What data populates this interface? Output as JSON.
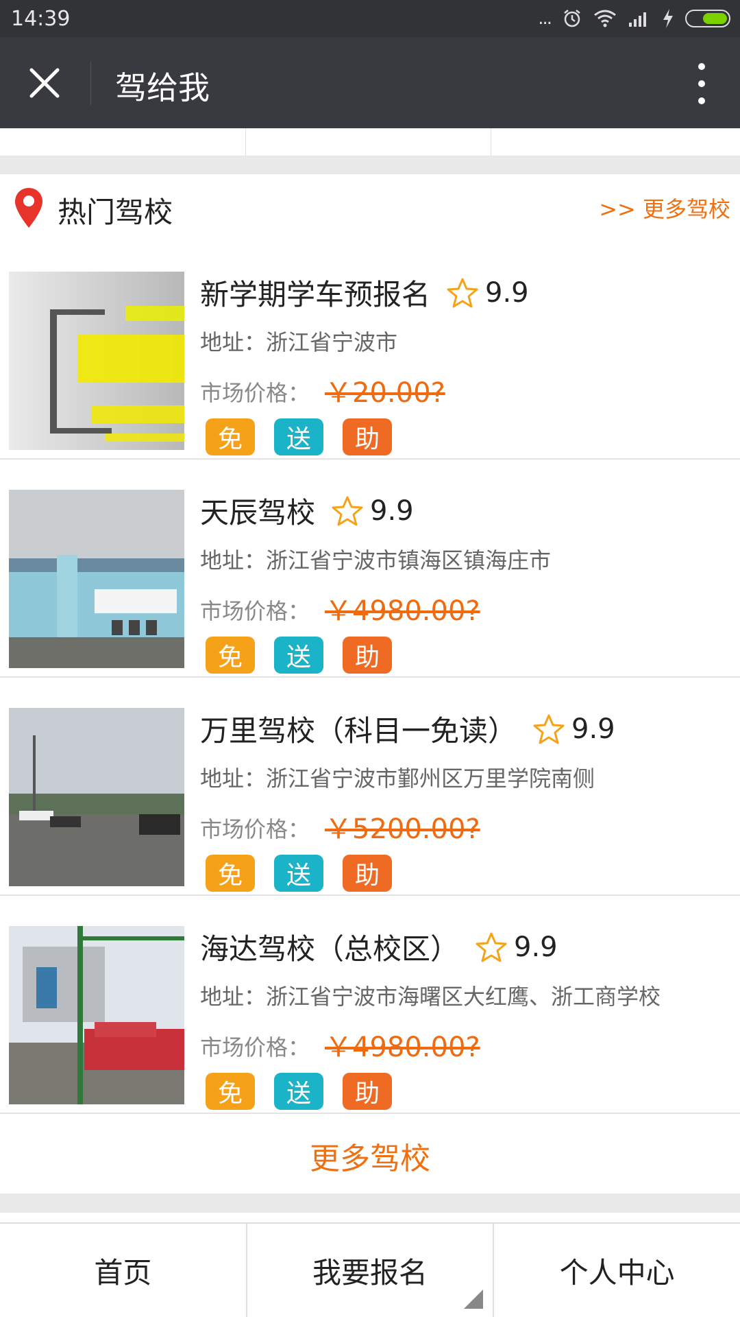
{
  "status_bar": {
    "time": "14:39",
    "dots": "...",
    "battery_color": "#7bd000"
  },
  "title_bar": {
    "title": "驾给我",
    "close_icon": "close-icon",
    "more_icon": "more-vertical-icon"
  },
  "section": {
    "title": "热门驾校",
    "more_link": ">> 更多驾校",
    "icon": "location-pin-icon"
  },
  "schools": [
    {
      "name": "新学期学车预报名",
      "rating": "9.9",
      "address": "地址：浙江省宁波市",
      "price_label": "市场价格：",
      "price": "￥20.00?",
      "badges": [
        "免",
        "送",
        "助"
      ]
    },
    {
      "name": "天辰驾校",
      "rating": "9.9",
      "address": "地址：浙江省宁波市镇海区镇海庄市",
      "price_label": "市场价格：",
      "price": "￥4980.00?",
      "badges": [
        "免",
        "送",
        "助"
      ]
    },
    {
      "name": "万里驾校（科目一免读）",
      "rating": "9.9",
      "address": "地址：浙江省宁波市鄞州区万里学院南侧",
      "price_label": "市场价格：",
      "price": "￥5200.00?",
      "badges": [
        "免",
        "送",
        "助"
      ]
    },
    {
      "name": "海达驾校（总校区）",
      "rating": "9.9",
      "address": "地址：浙江省宁波市海曙区大红鹰、浙工商学校",
      "price_label": "市场价格：",
      "price": "￥4980.00?",
      "badges": [
        "免",
        "送",
        "助"
      ]
    }
  ],
  "more_button": "更多驾校",
  "bottom_nav": [
    "首页",
    "我要报名",
    "个人中心"
  ],
  "colors": {
    "accent": "#f07010",
    "free": "#f5a219",
    "send": "#1ab3c8",
    "help": "#ef6a23",
    "title_bar": "#393a3f"
  }
}
